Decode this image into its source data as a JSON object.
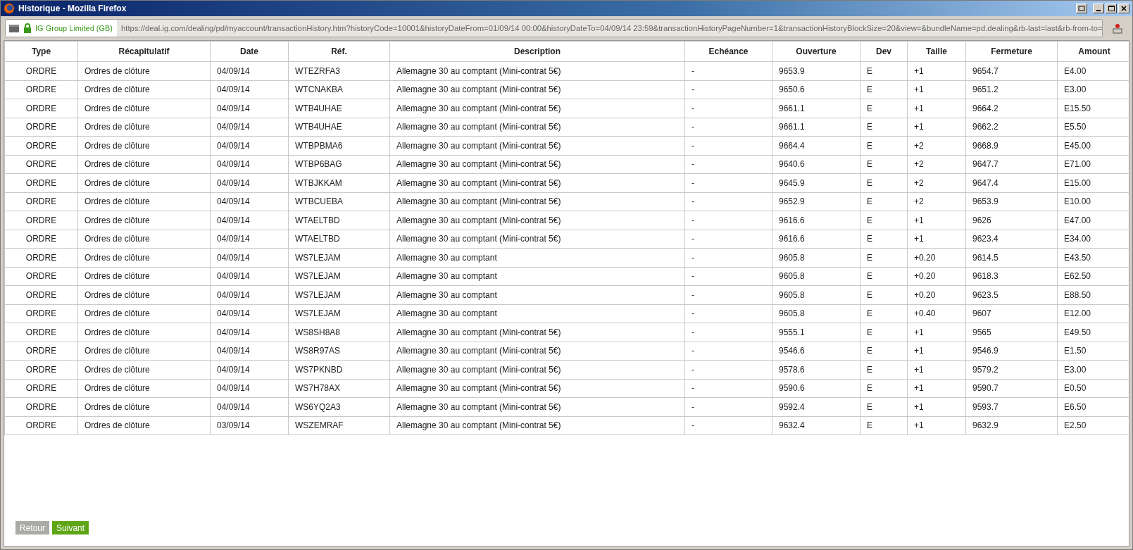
{
  "window": {
    "title": "Historique - Mozilla Firefox"
  },
  "address_bar": {
    "identity": "IG Group Limited (GB)",
    "url": "https://deal.ig.com/dealing/pd/myaccount/transactionHistory.htm?historyCode=10001&historyDateFrom=01/09/14 00:00&historyDateTo=04/09/14 23:59&transactionHistoryPageNumber=1&transactionHistoryBlockSize=20&view=&bundleName=pd.dealing&rb-last=last&rb-from-to="
  },
  "table": {
    "columns": [
      "Type",
      "Récapitulatif",
      "Date",
      "Réf.",
      "Description",
      "Echéance",
      "Ouverture",
      "Dev",
      "Taille",
      "Fermeture",
      "Amount"
    ],
    "rows": [
      [
        "ORDRE",
        "Ordres de clôture",
        "04/09/14",
        "WTEZRFA3",
        "Allemagne 30 au comptant (Mini-contrat 5€)",
        "-",
        "9653.9",
        "E",
        "+1",
        "9654.7",
        "E4.00"
      ],
      [
        "ORDRE",
        "Ordres de clôture",
        "04/09/14",
        "WTCNAKBA",
        "Allemagne 30 au comptant (Mini-contrat 5€)",
        "-",
        "9650.6",
        "E",
        "+1",
        "9651.2",
        "E3.00"
      ],
      [
        "ORDRE",
        "Ordres de clôture",
        "04/09/14",
        "WTB4UHAE",
        "Allemagne 30 au comptant (Mini-contrat 5€)",
        "-",
        "9661.1",
        "E",
        "+1",
        "9664.2",
        "E15.50"
      ],
      [
        "ORDRE",
        "Ordres de clôture",
        "04/09/14",
        "WTB4UHAE",
        "Allemagne 30 au comptant (Mini-contrat 5€)",
        "-",
        "9661.1",
        "E",
        "+1",
        "9662.2",
        "E5.50"
      ],
      [
        "ORDRE",
        "Ordres de clôture",
        "04/09/14",
        "WTBPBMA6",
        "Allemagne 30 au comptant (Mini-contrat 5€)",
        "-",
        "9664.4",
        "E",
        "+2",
        "9668.9",
        "E45.00"
      ],
      [
        "ORDRE",
        "Ordres de clôture",
        "04/09/14",
        "WTBP6BAG",
        "Allemagne 30 au comptant (Mini-contrat 5€)",
        "-",
        "9640.6",
        "E",
        "+2",
        "9647.7",
        "E71.00"
      ],
      [
        "ORDRE",
        "Ordres de clôture",
        "04/09/14",
        "WTBJKKAM",
        "Allemagne 30 au comptant (Mini-contrat 5€)",
        "-",
        "9645.9",
        "E",
        "+2",
        "9647.4",
        "E15.00"
      ],
      [
        "ORDRE",
        "Ordres de clôture",
        "04/09/14",
        "WTBCUEBA",
        "Allemagne 30 au comptant (Mini-contrat 5€)",
        "-",
        "9652.9",
        "E",
        "+2",
        "9653.9",
        "E10.00"
      ],
      [
        "ORDRE",
        "Ordres de clôture",
        "04/09/14",
        "WTAELTBD",
        "Allemagne 30 au comptant (Mini-contrat 5€)",
        "-",
        "9616.6",
        "E",
        "+1",
        "9626",
        "E47.00"
      ],
      [
        "ORDRE",
        "Ordres de clôture",
        "04/09/14",
        "WTAELTBD",
        "Allemagne 30 au comptant (Mini-contrat 5€)",
        "-",
        "9616.6",
        "E",
        "+1",
        "9623.4",
        "E34.00"
      ],
      [
        "ORDRE",
        "Ordres de clôture",
        "04/09/14",
        "WS7LEJAM",
        "Allemagne 30 au comptant",
        "-",
        "9605.8",
        "E",
        "+0.20",
        "9614.5",
        "E43.50"
      ],
      [
        "ORDRE",
        "Ordres de clôture",
        "04/09/14",
        "WS7LEJAM",
        "Allemagne 30 au comptant",
        "-",
        "9605.8",
        "E",
        "+0.20",
        "9618.3",
        "E62.50"
      ],
      [
        "ORDRE",
        "Ordres de clôture",
        "04/09/14",
        "WS7LEJAM",
        "Allemagne 30 au comptant",
        "-",
        "9605.8",
        "E",
        "+0.20",
        "9623.5",
        "E88.50"
      ],
      [
        "ORDRE",
        "Ordres de clôture",
        "04/09/14",
        "WS7LEJAM",
        "Allemagne 30 au comptant",
        "-",
        "9605.8",
        "E",
        "+0.40",
        "9607",
        "E12.00"
      ],
      [
        "ORDRE",
        "Ordres de clôture",
        "04/09/14",
        "WS8SH8A8",
        "Allemagne 30 au comptant (Mini-contrat 5€)",
        "-",
        "9555.1",
        "E",
        "+1",
        "9565",
        "E49.50"
      ],
      [
        "ORDRE",
        "Ordres de clôture",
        "04/09/14",
        "WS8R97AS",
        "Allemagne 30 au comptant (Mini-contrat 5€)",
        "-",
        "9546.6",
        "E",
        "+1",
        "9546.9",
        "E1.50"
      ],
      [
        "ORDRE",
        "Ordres de clôture",
        "04/09/14",
        "WS7PKNBD",
        "Allemagne 30 au comptant (Mini-contrat 5€)",
        "-",
        "9578.6",
        "E",
        "+1",
        "9579.2",
        "E3.00"
      ],
      [
        "ORDRE",
        "Ordres de clôture",
        "04/09/14",
        "WS7H78AX",
        "Allemagne 30 au comptant (Mini-contrat 5€)",
        "-",
        "9590.6",
        "E",
        "+1",
        "9590.7",
        "E0.50"
      ],
      [
        "ORDRE",
        "Ordres de clôture",
        "04/09/14",
        "WS6YQ2A3",
        "Allemagne 30 au comptant (Mini-contrat 5€)",
        "-",
        "9592.4",
        "E",
        "+1",
        "9593.7",
        "E6.50"
      ],
      [
        "ORDRE",
        "Ordres de clôture",
        "03/09/14",
        "WSZEMRAF",
        "Allemagne 30 au comptant (Mini-contrat 5€)",
        "-",
        "9632.4",
        "E",
        "+1",
        "9632.9",
        "E2.50"
      ]
    ]
  },
  "buttons": [
    {
      "label": "Retour",
      "disabled": true
    },
    {
      "label": "Suivant",
      "disabled": false
    }
  ]
}
